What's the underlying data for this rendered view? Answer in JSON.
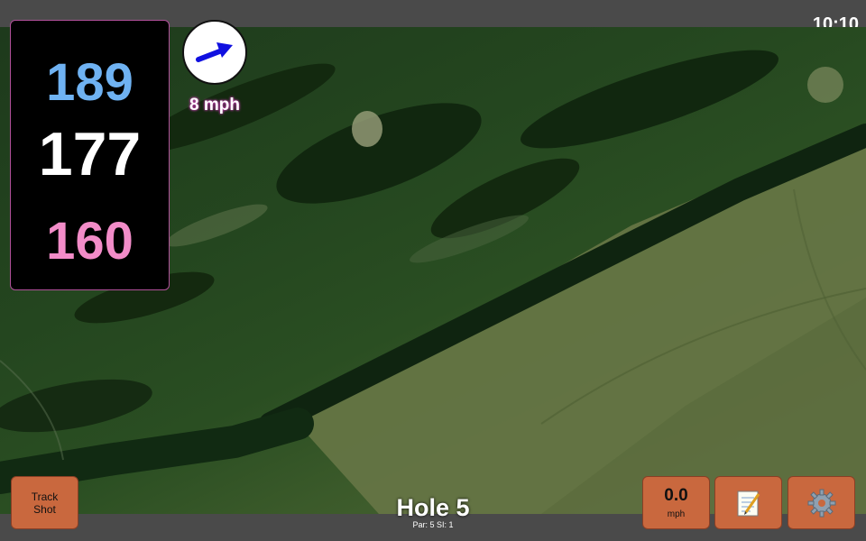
{
  "status_bar": {
    "time": "10:10"
  },
  "distances": {
    "back": "189",
    "center": "177",
    "front": "160"
  },
  "wind": {
    "speed": "8 mph",
    "direction_icon": "arrow-right-up-icon"
  },
  "hole": {
    "title": "Hole 5",
    "details": "Par: 5   SI: 1"
  },
  "buttons": {
    "track_shot_line1": "Track",
    "track_shot_line2": "Shot",
    "speed_value": "0.0",
    "speed_unit": "mph",
    "notes_icon": "notepad-icon",
    "settings_icon": "gear-icon"
  },
  "colors": {
    "back": "#6fb2f2",
    "center": "#ffffff",
    "front": "#f28cc8",
    "button": "#c9683e",
    "arrow": "#1010e0"
  }
}
